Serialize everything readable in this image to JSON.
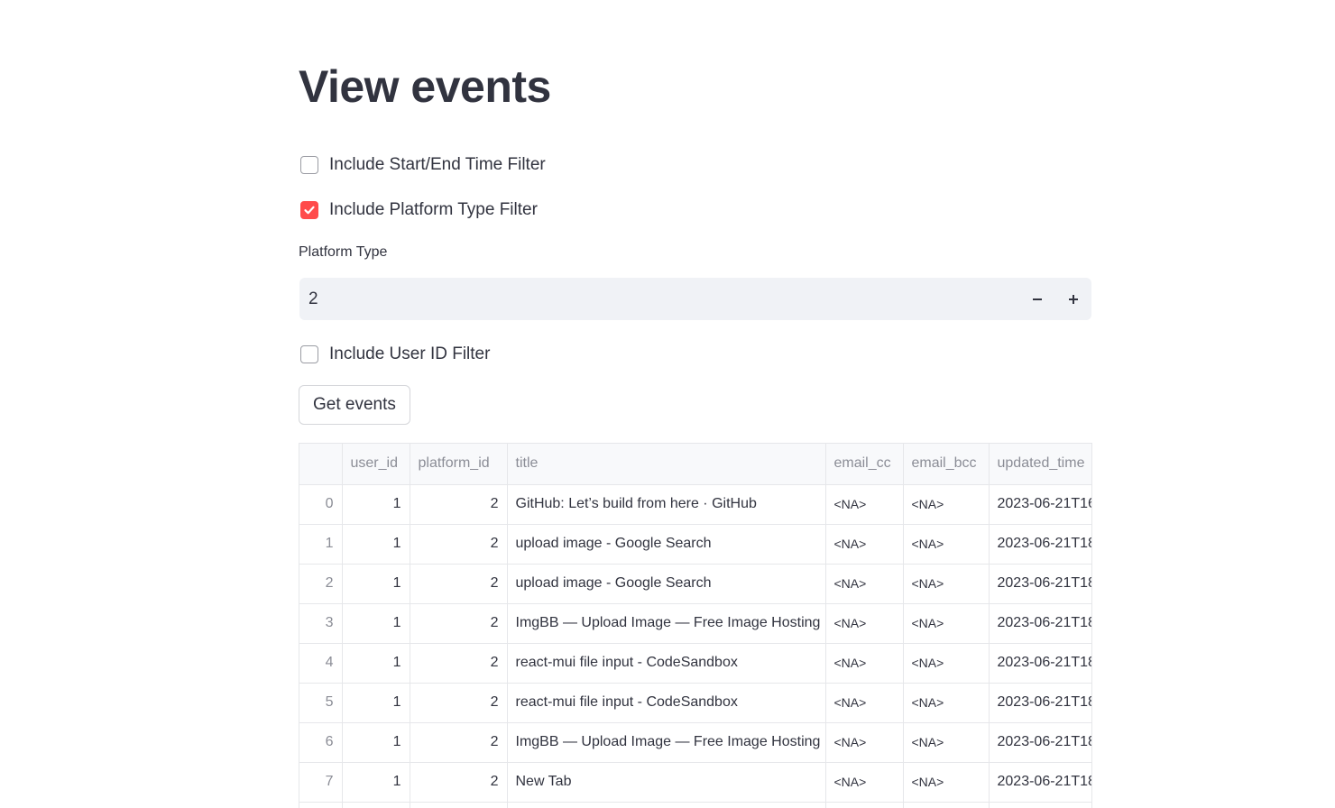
{
  "page": {
    "title": "View events"
  },
  "filters": {
    "time_filter": {
      "label": "Include Start/End Time Filter",
      "checked": false
    },
    "platform_filter": {
      "label": "Include Platform Type Filter",
      "checked": true
    },
    "platform_type": {
      "label": "Platform Type",
      "value": "2",
      "decrement": "−",
      "increment": "+"
    },
    "user_filter": {
      "label": "Include User ID Filter",
      "checked": false
    }
  },
  "actions": {
    "get_events_label": "Get events"
  },
  "colors": {
    "accent": "#ff4b4b",
    "input_bg": "#f0f2f6",
    "text": "#31333f"
  },
  "table": {
    "columns": [
      "",
      "user_id",
      "platform_id",
      "title",
      "email_cc",
      "email_bcc",
      "updated_time"
    ],
    "rows": [
      [
        "0",
        "1",
        "2",
        "GitHub: Let’s build from here · GitHub",
        "<NA>",
        "<NA>",
        "2023-06-21T16"
      ],
      [
        "1",
        "1",
        "2",
        "upload image - Google Search",
        "<NA>",
        "<NA>",
        "2023-06-21T18"
      ],
      [
        "2",
        "1",
        "2",
        "upload image - Google Search",
        "<NA>",
        "<NA>",
        "2023-06-21T18"
      ],
      [
        "3",
        "1",
        "2",
        "ImgBB — Upload Image — Free Image Hosting",
        "<NA>",
        "<NA>",
        "2023-06-21T18"
      ],
      [
        "4",
        "1",
        "2",
        "react-mui file input - CodeSandbox",
        "<NA>",
        "<NA>",
        "2023-06-21T18"
      ],
      [
        "5",
        "1",
        "2",
        "react-mui file input - CodeSandbox",
        "<NA>",
        "<NA>",
        "2023-06-21T18"
      ],
      [
        "6",
        "1",
        "2",
        "ImgBB — Upload Image — Free Image Hosting",
        "<NA>",
        "<NA>",
        "2023-06-21T18"
      ],
      [
        "7",
        "1",
        "2",
        "New Tab",
        "<NA>",
        "<NA>",
        "2023-06-21T18"
      ]
    ]
  }
}
